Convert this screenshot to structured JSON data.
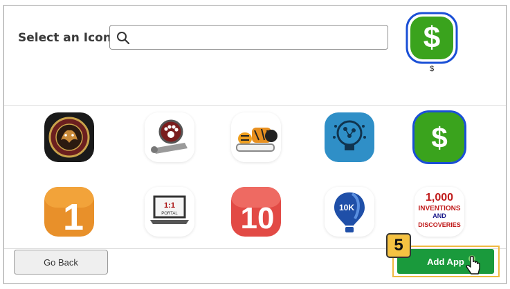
{
  "header": {
    "title": "Select an Icon",
    "search_placeholder": "",
    "search_value": ""
  },
  "preview": {
    "glyph": "$",
    "label": "$"
  },
  "icons": [
    {
      "name": "school-crest-icon"
    },
    {
      "name": "paw-film-icon"
    },
    {
      "name": "tiger-reading-icon"
    },
    {
      "name": "lightbulb-ideas-icon"
    },
    {
      "name": "cash-app-icon",
      "glyph": "$",
      "selected": true
    },
    {
      "name": "number-one-icon",
      "glyph": "1"
    },
    {
      "name": "one-to-one-portal-icon",
      "line1": "1:1",
      "line2": "PORTAL"
    },
    {
      "name": "number-ten-icon",
      "glyph": "10"
    },
    {
      "name": "10k-balloon-icon",
      "glyph": "10K"
    },
    {
      "name": "inventions-book-icon",
      "line1": "1,000",
      "line2": "INVENTIONS",
      "line3": "AND",
      "line4": "DISCOVERIES"
    }
  ],
  "footer": {
    "back_label": "Go Back",
    "add_label": "Add App",
    "step_number": "5"
  },
  "colors": {
    "green": "#3aa31d",
    "selected_border": "#1a4fd6",
    "add_button": "#1a9a3c",
    "highlight": "#f0b940"
  }
}
